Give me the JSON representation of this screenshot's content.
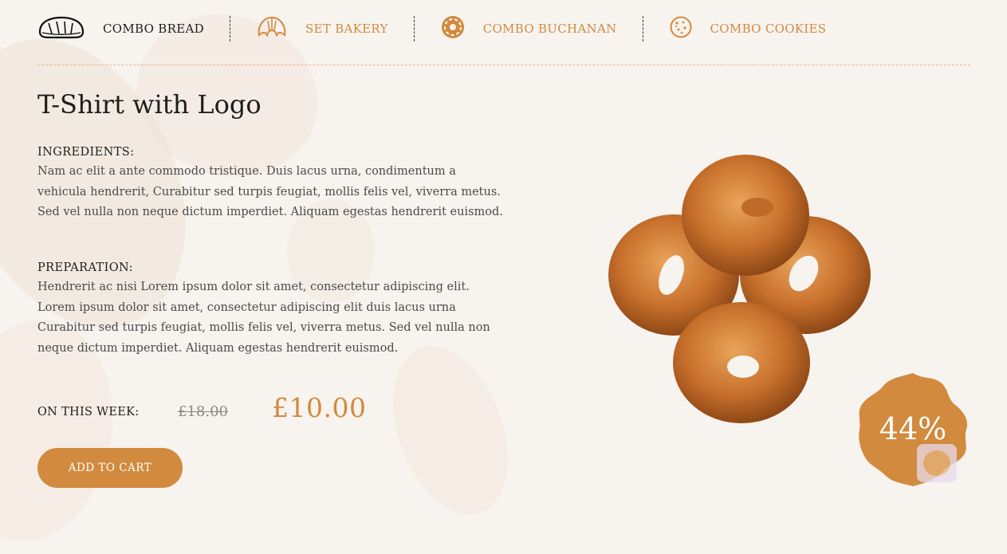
{
  "tabs": [
    {
      "label": "COMBO BREAD",
      "icon": "bread-icon"
    },
    {
      "label": "SET BAKERY",
      "icon": "croissant-icon"
    },
    {
      "label": "COMBO BUCHANAN",
      "icon": "donut-icon"
    },
    {
      "label": "COMBO COOKIES",
      "icon": "cookie-icon"
    }
  ],
  "product": {
    "title": "T-Shirt with Logo",
    "ingredients_label": "INGREDIENTS:",
    "ingredients_text": "Nam ac elit a ante commodo tristique. Duis lacus urna, condimentum a vehicula hendrerit, Curabitur sed turpis feugiat, mollis felis vel, viverra metus. Sed vel nulla non neque dictum imperdiet. Aliquam egestas hendrerit euismod.",
    "preparation_label": "PREPARATION:",
    "preparation_text": "Hendrerit ac nisi Lorem ipsum dolor sit amet, consectetur adipiscing elit. Lorem ipsum dolor sit amet, consectetur adipiscing elit duis lacus urna Curabitur sed turpis feugiat, mollis felis vel, viverra metus. Sed vel nulla non neque dictum imperdiet. Aliquam egestas hendrerit euismod.",
    "week_label": "ON THIS WEEK:",
    "old_price": "£18.00",
    "new_price": "£10.00",
    "cta_label": "ADD TO CART",
    "discount": "44%"
  },
  "colors": {
    "accent": "#d18a3e",
    "background": "#f7f3ef",
    "text": "#1d1d1d"
  }
}
